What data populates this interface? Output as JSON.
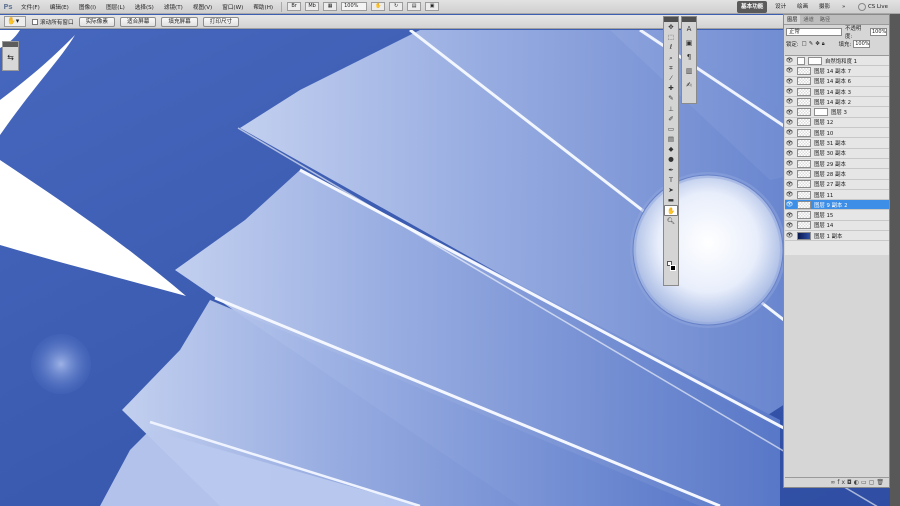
{
  "app": {
    "logo": "Ps"
  },
  "menu": {
    "items": [
      "文件(F)",
      "编辑(E)",
      "图像(I)",
      "图层(L)",
      "选择(S)",
      "滤镜(T)",
      "视图(V)",
      "窗口(W)",
      "帮助(H)"
    ],
    "mini_buttons": [
      "Br",
      "Mb"
    ],
    "zoom": "100%",
    "workspaces": [
      "基本功能",
      "设计",
      "绘画",
      "摄影"
    ],
    "active_workspace": "基本功能",
    "more": "»",
    "cs_live": "CS Live"
  },
  "options": {
    "tool_preset_icon": "hand-icon",
    "scroll_all_windows": "滚动所有窗口",
    "buttons": [
      "实际像素",
      "适合屏幕",
      "填充屏幕",
      "打印尺寸"
    ]
  },
  "toolbox": {
    "tools": [
      "move",
      "marquee",
      "lasso",
      "quick-select",
      "crop",
      "eyedropper",
      "healing",
      "brush",
      "stamp",
      "history-brush",
      "eraser",
      "gradient",
      "blur",
      "dodge",
      "pen",
      "type",
      "path-select",
      "shape",
      "hand",
      "zoom"
    ],
    "active_tool": "hand"
  },
  "mini_panel": {
    "icons": [
      "character",
      "paragraph-style",
      "paragraph",
      "channels",
      "adjust"
    ]
  },
  "layers_panel": {
    "tabs": [
      "图层",
      "通道",
      "路径"
    ],
    "blend_mode": "正常",
    "opacity_label": "不透明度:",
    "opacity": "100%",
    "lock_label": "锁定:",
    "fill_label": "填充:",
    "fill": "100%",
    "layers": [
      {
        "name": "自然饱和度 1",
        "kind": "adjustment"
      },
      {
        "name": "图层 14 副本 7",
        "kind": "pixel"
      },
      {
        "name": "图层 14 副本 6",
        "kind": "pixel"
      },
      {
        "name": "图层 14 副本 3",
        "kind": "pixel"
      },
      {
        "name": "图层 14 副本 2",
        "kind": "pixel"
      },
      {
        "name": "图层 3",
        "kind": "masked"
      },
      {
        "name": "图层 12",
        "kind": "pixel"
      },
      {
        "name": "图层 10",
        "kind": "pixel"
      },
      {
        "name": "图层 31 副本",
        "kind": "pixel"
      },
      {
        "name": "图层 30 副本",
        "kind": "pixel"
      },
      {
        "name": "图层 29 副本",
        "kind": "pixel"
      },
      {
        "name": "图层 28 副本",
        "kind": "pixel"
      },
      {
        "name": "图层 27 副本",
        "kind": "pixel"
      },
      {
        "name": "图层 11",
        "kind": "pixel"
      },
      {
        "name": "图层 9 副本 2",
        "kind": "pixel",
        "selected": true
      },
      {
        "name": "图层 15",
        "kind": "pixel"
      },
      {
        "name": "图层 14",
        "kind": "pixel"
      },
      {
        "name": "图层 1 副本",
        "kind": "dark"
      }
    ],
    "footer_icons": [
      "link-icon",
      "fx-icon",
      "mask-icon",
      "adjustment-icon",
      "group-icon",
      "new-layer-icon",
      "trash-icon"
    ]
  },
  "colors": {
    "canvas_bg": "#3c5fb4",
    "selected_layer": "#3d8ee6",
    "panel_bg": "#d6d6d6"
  }
}
